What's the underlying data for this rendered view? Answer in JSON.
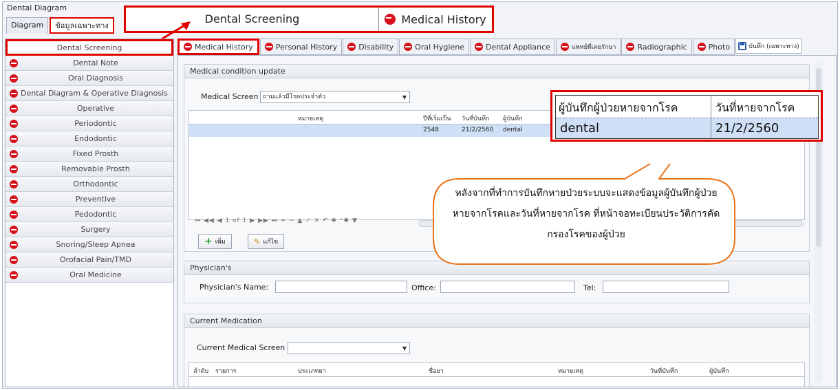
{
  "window": {
    "title": "Dental Diagram"
  },
  "top_tabs": [
    "Diagram",
    "ข้อมูลเฉพาะทาง"
  ],
  "callout_tabs": {
    "tab1": "Dental Screening",
    "tab2": "Medical History"
  },
  "left_menu": {
    "active": "Dental Screening",
    "items": [
      "Dental Note",
      "Oral Diagnosis",
      "Dental Diagram & Operative Diagnosis",
      "Operative",
      "Periodontic",
      "Endodontic",
      "Fixed Prosth",
      "Removable Prosth",
      "Orthodontic",
      "Preventive",
      "Pedodontic",
      "Surgery",
      "Snoring/Sleep Apnea",
      "Orofacial Pain/TMD",
      "Oral Medicine"
    ]
  },
  "sub_tabs": [
    "Medical History",
    "Personal History",
    "Disability",
    "Oral Hygiene",
    "Dental Appliance",
    "แพทย์ที่เคยรักษา",
    "Radiographic",
    "Photo"
  ],
  "save_label": "บันทึก (เฉพาะทาง)",
  "medical_condition": {
    "title": "Medical condition update",
    "screen_label": "Medical Screen",
    "screen_value": "ถามแล้วมีโรคประจำตัว",
    "columns": [
      "หมายเหตุ",
      "ปีที่เริ่มเป็น",
      "วันที่บันทึก",
      "ผู้บันทึก"
    ],
    "row": {
      "note": "",
      "year": "2548",
      "date": "21/2/2560",
      "recorder": "dental"
    },
    "nav": "⏮ ◀◀ ◀ 1 of 1 ▶ ▶▶ ⏭ + − ▲ ✓ ✕ ↶ ✱ ⁺✱ ▼",
    "add_label": "เพิ่ม",
    "edit_label": "แก้ไข"
  },
  "zoom": {
    "col1": "ผู้บันทึกผู้ป่วยหายจากโรค",
    "col2": "วันที่หายจากโรค",
    "val1": "dental",
    "val2": "21/2/2560"
  },
  "speech_text": "หลังจากที่ทำการบันทึกหายป่วยระบบจะแสดงข้อมูลผู้บันทึกผู้ป่วยหายจากโรคและวันที่หายจากโรค ที่หน้าจอทะเบียนประวัติการคัดกรองโรคของผู้ป่วย",
  "physician": {
    "title": "Physician's",
    "name_label": "Physician's Name:",
    "office_label": "Office:",
    "tel_label": "Tel:"
  },
  "current_medication": {
    "title": "Current Medication",
    "screen_label": "Current Medical Screen",
    "columns": [
      "ลำดับ",
      "รายการ",
      "ประเภทยา",
      "ชื่อยา",
      "หมายเหตุ",
      "วันที่บันทึก",
      "ผู้บันทึก"
    ]
  },
  "colors": {
    "highlight_red": "#e00000",
    "no_icon_red": "#d8101a",
    "selected_row": "#cfe0f6",
    "bubble_border": "#e8731c"
  }
}
